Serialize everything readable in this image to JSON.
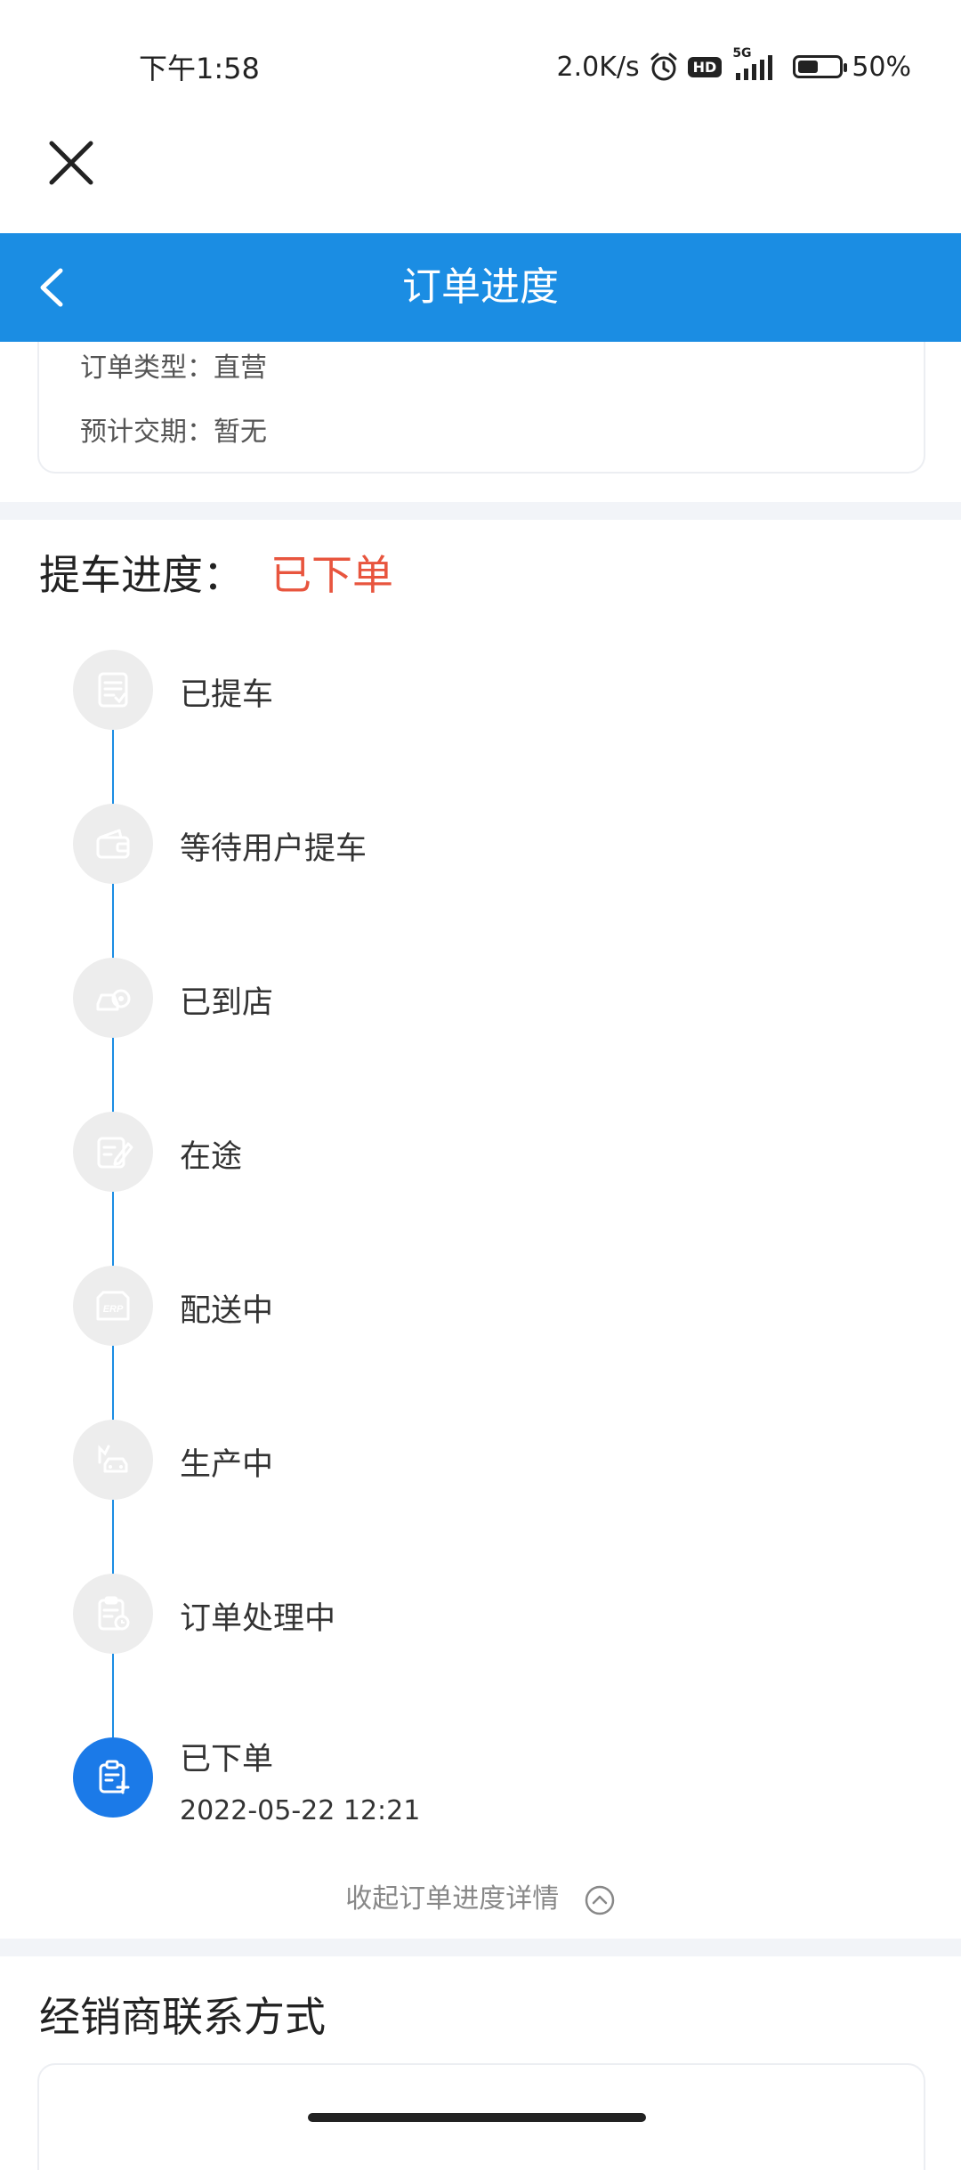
{
  "status_bar": {
    "time": "下午1:58",
    "network_speed": "2.0K/s",
    "hd_label": "HD",
    "signal_label": "5G",
    "battery_level": 0.5,
    "battery_text": "50%"
  },
  "header": {
    "title": "订单进度"
  },
  "order_info": {
    "order_type": "订单类型：直营",
    "expected_delivery": "预计交期：暂无"
  },
  "progress": {
    "title_label": "提车进度：",
    "current_status": "已下单",
    "accent_color": "#e8553e",
    "steps": [
      {
        "label": "已提车",
        "icon": "document-check-icon"
      },
      {
        "label": "等待用户提车",
        "icon": "wallet-icon"
      },
      {
        "label": "已到店",
        "icon": "car-store-icon"
      },
      {
        "label": "在途",
        "icon": "edit-document-icon"
      },
      {
        "label": "配送中",
        "icon": "erp-truck-icon"
      },
      {
        "label": "生产中",
        "icon": "factory-car-icon"
      },
      {
        "label": "订单处理中",
        "icon": "clipboard-clock-icon"
      },
      {
        "label": "已下单",
        "icon": "clipboard-add-icon",
        "date": "2022-05-22 12:21",
        "active": true
      }
    ],
    "collapse_label": "收起订单进度详情"
  },
  "dealer": {
    "title": "经销商联系方式"
  },
  "colors": {
    "primary": "#1b8de3",
    "active_step": "#1b7ae8"
  }
}
